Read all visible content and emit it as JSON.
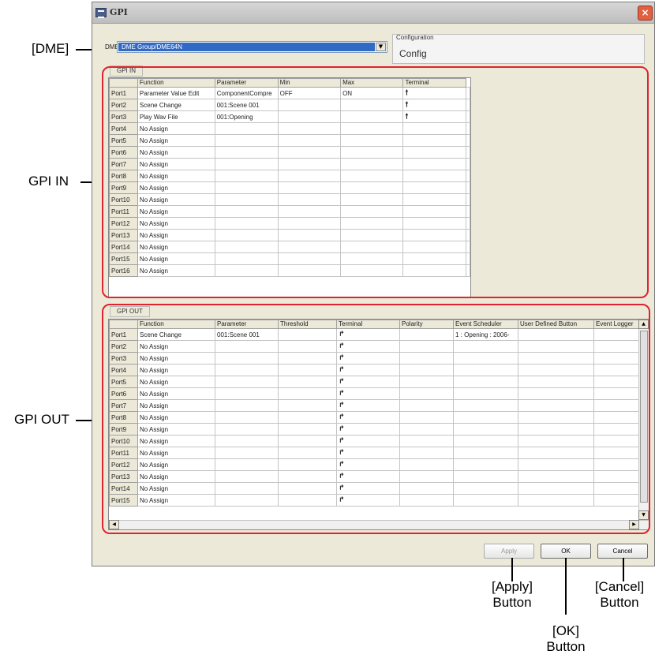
{
  "window": {
    "title": "GPI",
    "close_glyph": "×"
  },
  "dme": {
    "label": "DME",
    "value": "DME Group/DME64N",
    "arrow": "▼"
  },
  "configuration": {
    "title": "Configuration",
    "value": "Config"
  },
  "gpi_in": {
    "tab_label": "GPI IN",
    "columns": [
      "Function",
      "Parameter",
      "Min",
      "Max",
      "Terminal"
    ],
    "rows": [
      {
        "port": "Port1",
        "function": "Parameter Value Edit",
        "parameter": "ComponentCompre",
        "min": "OFF",
        "max": "ON",
        "terminal": "🠕"
      },
      {
        "port": "Port2",
        "function": "Scene Change",
        "parameter": "001:Scene 001",
        "min": "",
        "max": "",
        "terminal": "🠕"
      },
      {
        "port": "Port3",
        "function": "Play Wav File",
        "parameter": "001:Opening",
        "min": "",
        "max": "",
        "terminal": "🠕"
      },
      {
        "port": "Port4",
        "function": "No Assign",
        "parameter": "",
        "min": "",
        "max": "",
        "terminal": ""
      },
      {
        "port": "Port5",
        "function": "No Assign",
        "parameter": "",
        "min": "",
        "max": "",
        "terminal": ""
      },
      {
        "port": "Port6",
        "function": "No Assign",
        "parameter": "",
        "min": "",
        "max": "",
        "terminal": ""
      },
      {
        "port": "Port7",
        "function": "No Assign",
        "parameter": "",
        "min": "",
        "max": "",
        "terminal": ""
      },
      {
        "port": "Port8",
        "function": "No Assign",
        "parameter": "",
        "min": "",
        "max": "",
        "terminal": ""
      },
      {
        "port": "Port9",
        "function": "No Assign",
        "parameter": "",
        "min": "",
        "max": "",
        "terminal": ""
      },
      {
        "port": "Port10",
        "function": "No Assign",
        "parameter": "",
        "min": "",
        "max": "",
        "terminal": ""
      },
      {
        "port": "Port11",
        "function": "No Assign",
        "parameter": "",
        "min": "",
        "max": "",
        "terminal": ""
      },
      {
        "port": "Port12",
        "function": "No Assign",
        "parameter": "",
        "min": "",
        "max": "",
        "terminal": ""
      },
      {
        "port": "Port13",
        "function": "No Assign",
        "parameter": "",
        "min": "",
        "max": "",
        "terminal": ""
      },
      {
        "port": "Port14",
        "function": "No Assign",
        "parameter": "",
        "min": "",
        "max": "",
        "terminal": ""
      },
      {
        "port": "Port15",
        "function": "No Assign",
        "parameter": "",
        "min": "",
        "max": "",
        "terminal": ""
      },
      {
        "port": "Port16",
        "function": "No Assign",
        "parameter": "",
        "min": "",
        "max": "",
        "terminal": ""
      }
    ]
  },
  "gpi_out": {
    "tab_label": "GPI OUT",
    "columns": [
      "Function",
      "Parameter",
      "Threshold",
      "Terminal",
      "Polarity",
      "Event Scheduler",
      "User Defined Button",
      "Event Logger"
    ],
    "rows": [
      {
        "port": "Port1",
        "function": "Scene Change",
        "parameter": "001:Scene 001",
        "threshold": "",
        "terminal": "↱",
        "polarity": "",
        "event_scheduler": "1 : Opening : 2006-",
        "user_defined_button": "",
        "event_logger": ""
      },
      {
        "port": "Port2",
        "function": "No Assign",
        "parameter": "",
        "threshold": "",
        "terminal": "↱",
        "polarity": "",
        "event_scheduler": "",
        "user_defined_button": "",
        "event_logger": ""
      },
      {
        "port": "Port3",
        "function": "No Assign",
        "parameter": "",
        "threshold": "",
        "terminal": "↱",
        "polarity": "",
        "event_scheduler": "",
        "user_defined_button": "",
        "event_logger": ""
      },
      {
        "port": "Port4",
        "function": "No Assign",
        "parameter": "",
        "threshold": "",
        "terminal": "↱",
        "polarity": "",
        "event_scheduler": "",
        "user_defined_button": "",
        "event_logger": ""
      },
      {
        "port": "Port5",
        "function": "No Assign",
        "parameter": "",
        "threshold": "",
        "terminal": "↱",
        "polarity": "",
        "event_scheduler": "",
        "user_defined_button": "",
        "event_logger": ""
      },
      {
        "port": "Port6",
        "function": "No Assign",
        "parameter": "",
        "threshold": "",
        "terminal": "↱",
        "polarity": "",
        "event_scheduler": "",
        "user_defined_button": "",
        "event_logger": ""
      },
      {
        "port": "Port7",
        "function": "No Assign",
        "parameter": "",
        "threshold": "",
        "terminal": "↱",
        "polarity": "",
        "event_scheduler": "",
        "user_defined_button": "",
        "event_logger": ""
      },
      {
        "port": "Port8",
        "function": "No Assign",
        "parameter": "",
        "threshold": "",
        "terminal": "↱",
        "polarity": "",
        "event_scheduler": "",
        "user_defined_button": "",
        "event_logger": ""
      },
      {
        "port": "Port9",
        "function": "No Assign",
        "parameter": "",
        "threshold": "",
        "terminal": "↱",
        "polarity": "",
        "event_scheduler": "",
        "user_defined_button": "",
        "event_logger": ""
      },
      {
        "port": "Port10",
        "function": "No Assign",
        "parameter": "",
        "threshold": "",
        "terminal": "↱",
        "polarity": "",
        "event_scheduler": "",
        "user_defined_button": "",
        "event_logger": ""
      },
      {
        "port": "Port11",
        "function": "No Assign",
        "parameter": "",
        "threshold": "",
        "terminal": "↱",
        "polarity": "",
        "event_scheduler": "",
        "user_defined_button": "",
        "event_logger": ""
      },
      {
        "port": "Port12",
        "function": "No Assign",
        "parameter": "",
        "threshold": "",
        "terminal": "↱",
        "polarity": "",
        "event_scheduler": "",
        "user_defined_button": "",
        "event_logger": ""
      },
      {
        "port": "Port13",
        "function": "No Assign",
        "parameter": "",
        "threshold": "",
        "terminal": "↱",
        "polarity": "",
        "event_scheduler": "",
        "user_defined_button": "",
        "event_logger": ""
      },
      {
        "port": "Port14",
        "function": "No Assign",
        "parameter": "",
        "threshold": "",
        "terminal": "↱",
        "polarity": "",
        "event_scheduler": "",
        "user_defined_button": "",
        "event_logger": ""
      },
      {
        "port": "Port15",
        "function": "No Assign",
        "parameter": "",
        "threshold": "",
        "terminal": "↱",
        "polarity": "",
        "event_scheduler": "",
        "user_defined_button": "",
        "event_logger": ""
      }
    ]
  },
  "buttons": {
    "apply": "Apply",
    "ok": "OK",
    "cancel": "Cancel"
  },
  "annotations": {
    "dme": "[DME]",
    "gpi_in": "GPI IN",
    "gpi_out": "GPI OUT",
    "apply_line1": "[Apply]",
    "apply_line2": "Button",
    "ok_line1": "[OK]",
    "ok_line2": "Button",
    "cancel_line1": "[Cancel]",
    "cancel_line2": "Button"
  },
  "colors": {
    "highlight": "#e0232e",
    "selection": "#316ac5",
    "dialog_bg": "#ece9d8"
  },
  "icons": {
    "window": "gpi-window-icon",
    "close": "close-icon",
    "dropdown": "dropdown-arrow-icon",
    "gpi_in_terminal": "up-arrow-icon",
    "gpi_out_terminal": "turn-arrow-icon"
  }
}
